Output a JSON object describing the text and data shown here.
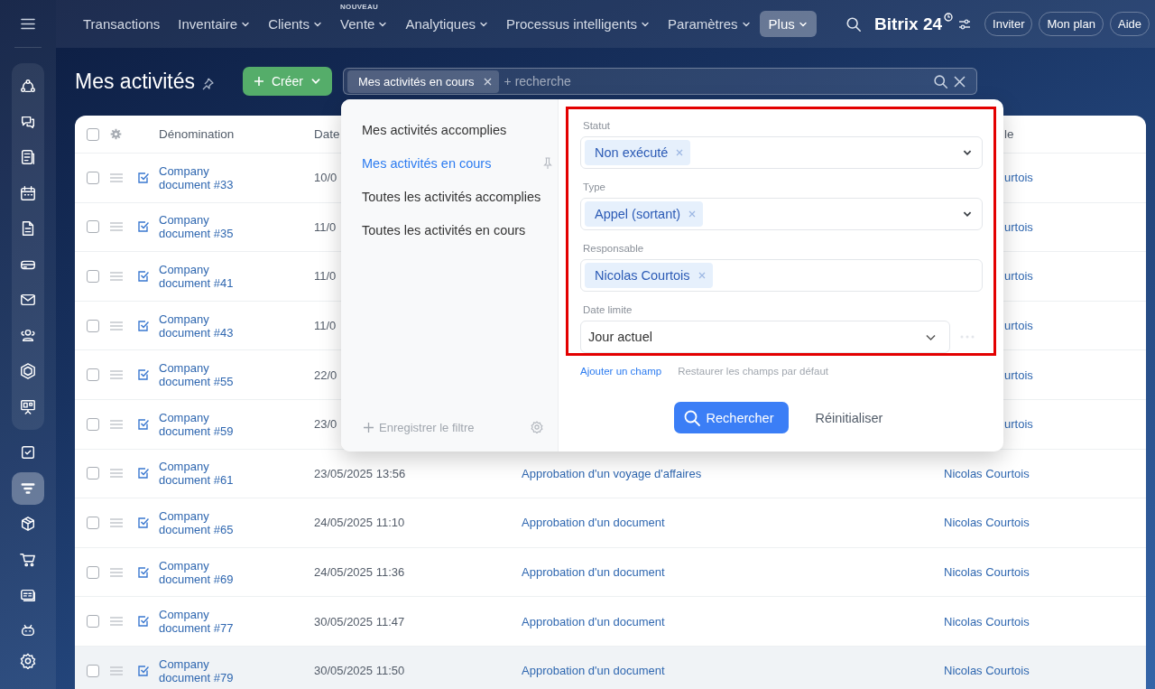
{
  "topbar": {
    "nav": [
      {
        "label": "Transactions",
        "dropdown": false,
        "selected": false
      },
      {
        "label": "Inventaire",
        "dropdown": true,
        "selected": false
      },
      {
        "label": "Clients",
        "dropdown": true,
        "selected": false
      },
      {
        "label": "Vente",
        "dropdown": true,
        "selected": false,
        "badge": "NOUVEAU"
      },
      {
        "label": "Analytiques",
        "dropdown": true,
        "selected": false
      },
      {
        "label": "Processus intelligents",
        "dropdown": true,
        "selected": false
      },
      {
        "label": "Paramètres",
        "dropdown": true,
        "selected": false
      },
      {
        "label": "Plus",
        "dropdown": true,
        "selected": true
      }
    ],
    "logo": "Bitrix 24",
    "buttons": [
      "Inviter",
      "Mon plan",
      "Aide"
    ]
  },
  "sidebar": {
    "pinned_items": [
      {
        "selected": false
      },
      {
        "selected": false
      },
      {
        "selected": false
      },
      {
        "selected": false
      },
      {
        "selected": false
      },
      {
        "selected": false
      },
      {
        "selected": false
      },
      {
        "selected": false
      },
      {
        "selected": false
      },
      {
        "selected": false
      }
    ],
    "items": [
      {
        "selected": false
      },
      {
        "selected": true
      },
      {
        "selected": false
      },
      {
        "selected": false
      },
      {
        "selected": false
      },
      {
        "selected": false
      }
    ]
  },
  "page": {
    "title": "Mes activités",
    "create_button": "Créer",
    "search": {
      "chip": "Mes activités en cours",
      "placeholder": "+ recherche"
    }
  },
  "table": {
    "select_all": {
      "checked": false
    },
    "columns": [
      {
        "label": "Dénomination"
      },
      {
        "label": "Date"
      },
      {
        "label": "le",
        "kind": "covered"
      }
    ],
    "rows": [
      {
        "kind": "covered",
        "name": "Company document #33",
        "date": "10/0",
        "responsible": "urtois",
        "hovered": false
      },
      {
        "kind": "covered",
        "name": "Company document #35",
        "date": "11/0",
        "responsible": "urtois",
        "hovered": false
      },
      {
        "kind": "covered",
        "name": "Company document #41",
        "date": "11/0",
        "responsible": "urtois",
        "hovered": false
      },
      {
        "kind": "covered",
        "name": "Company document #43",
        "date": "11/0",
        "responsible": "urtois",
        "hovered": false
      },
      {
        "kind": "covered",
        "name": "Company document #55",
        "date": "22/0",
        "responsible": "urtois",
        "hovered": false
      },
      {
        "kind": "covered",
        "name": "Company document #59",
        "date": "23/0",
        "responsible": "urtois",
        "hovered": false
      },
      {
        "kind": "full",
        "name": "Company document #61",
        "date": "23/05/2025 13:56",
        "activity": "Approbation d'un voyage d'affaires",
        "responsible": "Nicolas Courtois",
        "hovered": false
      },
      {
        "kind": "full",
        "name": "Company document #65",
        "date": "24/05/2025 11:10",
        "activity": "Approbation d'un document",
        "responsible": "Nicolas Courtois",
        "hovered": false
      },
      {
        "kind": "full",
        "name": "Company document #69",
        "date": "24/05/2025 11:36",
        "activity": "Approbation d'un document",
        "responsible": "Nicolas Courtois",
        "hovered": false
      },
      {
        "kind": "full",
        "name": "Company document #77",
        "date": "30/05/2025 11:47",
        "activity": "Approbation d'un document",
        "responsible": "Nicolas Courtois",
        "hovered": false
      },
      {
        "kind": "full",
        "name": "Company document #79",
        "date": "30/05/2025 11:50",
        "activity": "Approbation d'un document",
        "responsible": "Nicolas Courtois",
        "hovered": true
      }
    ]
  },
  "filter_popup": {
    "presets": [
      {
        "label": "Mes activités accomplies",
        "selected": false
      },
      {
        "label": "Mes activités en cours",
        "selected": true
      },
      {
        "label": "Toutes les activités accomplies",
        "selected": false
      },
      {
        "label": "Toutes les activités en cours",
        "selected": false
      }
    ],
    "save_filter": "Enregistrer le filtre",
    "fields": [
      {
        "label": "Statut",
        "kind": "tags",
        "tags": [
          "Non exécuté"
        ],
        "dropdown": true
      },
      {
        "label": "Type",
        "kind": "tags",
        "tags": [
          "Appel (sortant)"
        ],
        "dropdown": true
      },
      {
        "label": "Responsable",
        "kind": "tags",
        "tags": [
          "Nicolas Courtois"
        ],
        "dropdown": false
      },
      {
        "label": "Date limite",
        "kind": "select",
        "value": "Jour actuel"
      }
    ],
    "add_field": "Ajouter un champ",
    "restore_fields": "Restaurer les champs par défaut",
    "search_button": "Rechercher",
    "reset_button": "Réinitialiser"
  }
}
